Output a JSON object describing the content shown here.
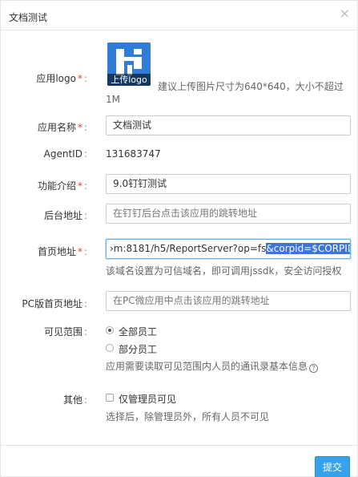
{
  "dialog": {
    "title": "文档测试",
    "close_symbol": "×",
    "icons": [
      "close-icon",
      "question-icon",
      "logo-image"
    ],
    "colors": {
      "accent": "#37a1ea",
      "required": "#e4393c",
      "logo": "#2f7dd9"
    }
  },
  "form": {
    "logo": {
      "label": "应用logo",
      "upload_text": "上传logo",
      "help_line1": "建议上传图片尺寸为640*640，大小不超过",
      "help_line2": "1M"
    },
    "name": {
      "label": "应用名称",
      "value": "文档测试"
    },
    "agent": {
      "label": "AgentID",
      "value": "131683747"
    },
    "intro": {
      "label": "功能介绍",
      "value": "9.0钉钉测试"
    },
    "backend": {
      "label": "后台地址",
      "placeholder": "在钉钉后台点击该应用的跳转地址"
    },
    "homepage": {
      "label": "首页地址",
      "value_prefix": "›m:8181/h5/ReportServer?op=fs",
      "value_selected": "&corpid=$CORPID$",
      "help": "该域名设置为可信域名，即可调用jssdk，安全访问授权"
    },
    "pc": {
      "label": "PC版首页地址",
      "placeholder": "在PC微应用中点击该应用的跳转地址"
    },
    "visibility": {
      "label": "可见范围",
      "options": [
        "全部员工",
        "部分员工"
      ],
      "selected": "全部员工",
      "help": "应用需要读取可见范围内人员的通讯录基本信息"
    },
    "other": {
      "label": "其他",
      "checkbox_label": "仅管理员可见",
      "help": "选择后，除管理员外，所有人员不可见"
    }
  },
  "footer": {
    "submit_label": "提交"
  }
}
